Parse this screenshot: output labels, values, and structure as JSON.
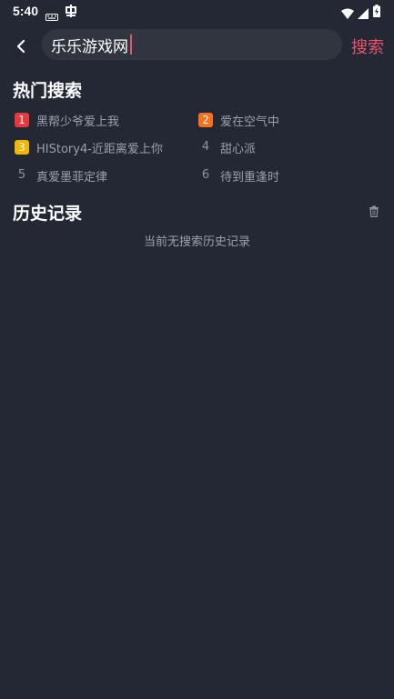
{
  "status": {
    "time": "5:40"
  },
  "search": {
    "query": "乐乐游戏网",
    "button_label": "搜索"
  },
  "hot": {
    "title": "热门搜索",
    "items": [
      {
        "rank": "1",
        "label": "黑帮少爷爱上我",
        "rank_color": "#e8383d"
      },
      {
        "rank": "2",
        "label": "爱在空气中",
        "rank_color": "#f5731f"
      },
      {
        "rank": "3",
        "label": "HIStory4-近距离爱上你",
        "rank_color": "#f2b705"
      },
      {
        "rank": "4",
        "label": "甜心派",
        "rank_color": ""
      },
      {
        "rank": "5",
        "label": "真爱墨菲定律",
        "rank_color": ""
      },
      {
        "rank": "6",
        "label": "待到重逢时",
        "rank_color": ""
      }
    ]
  },
  "history": {
    "title": "历史记录",
    "empty_text": "当前无搜索历史记录"
  },
  "colors": {
    "background": "#242835",
    "accent": "#e9536b",
    "field": "#30353f"
  }
}
